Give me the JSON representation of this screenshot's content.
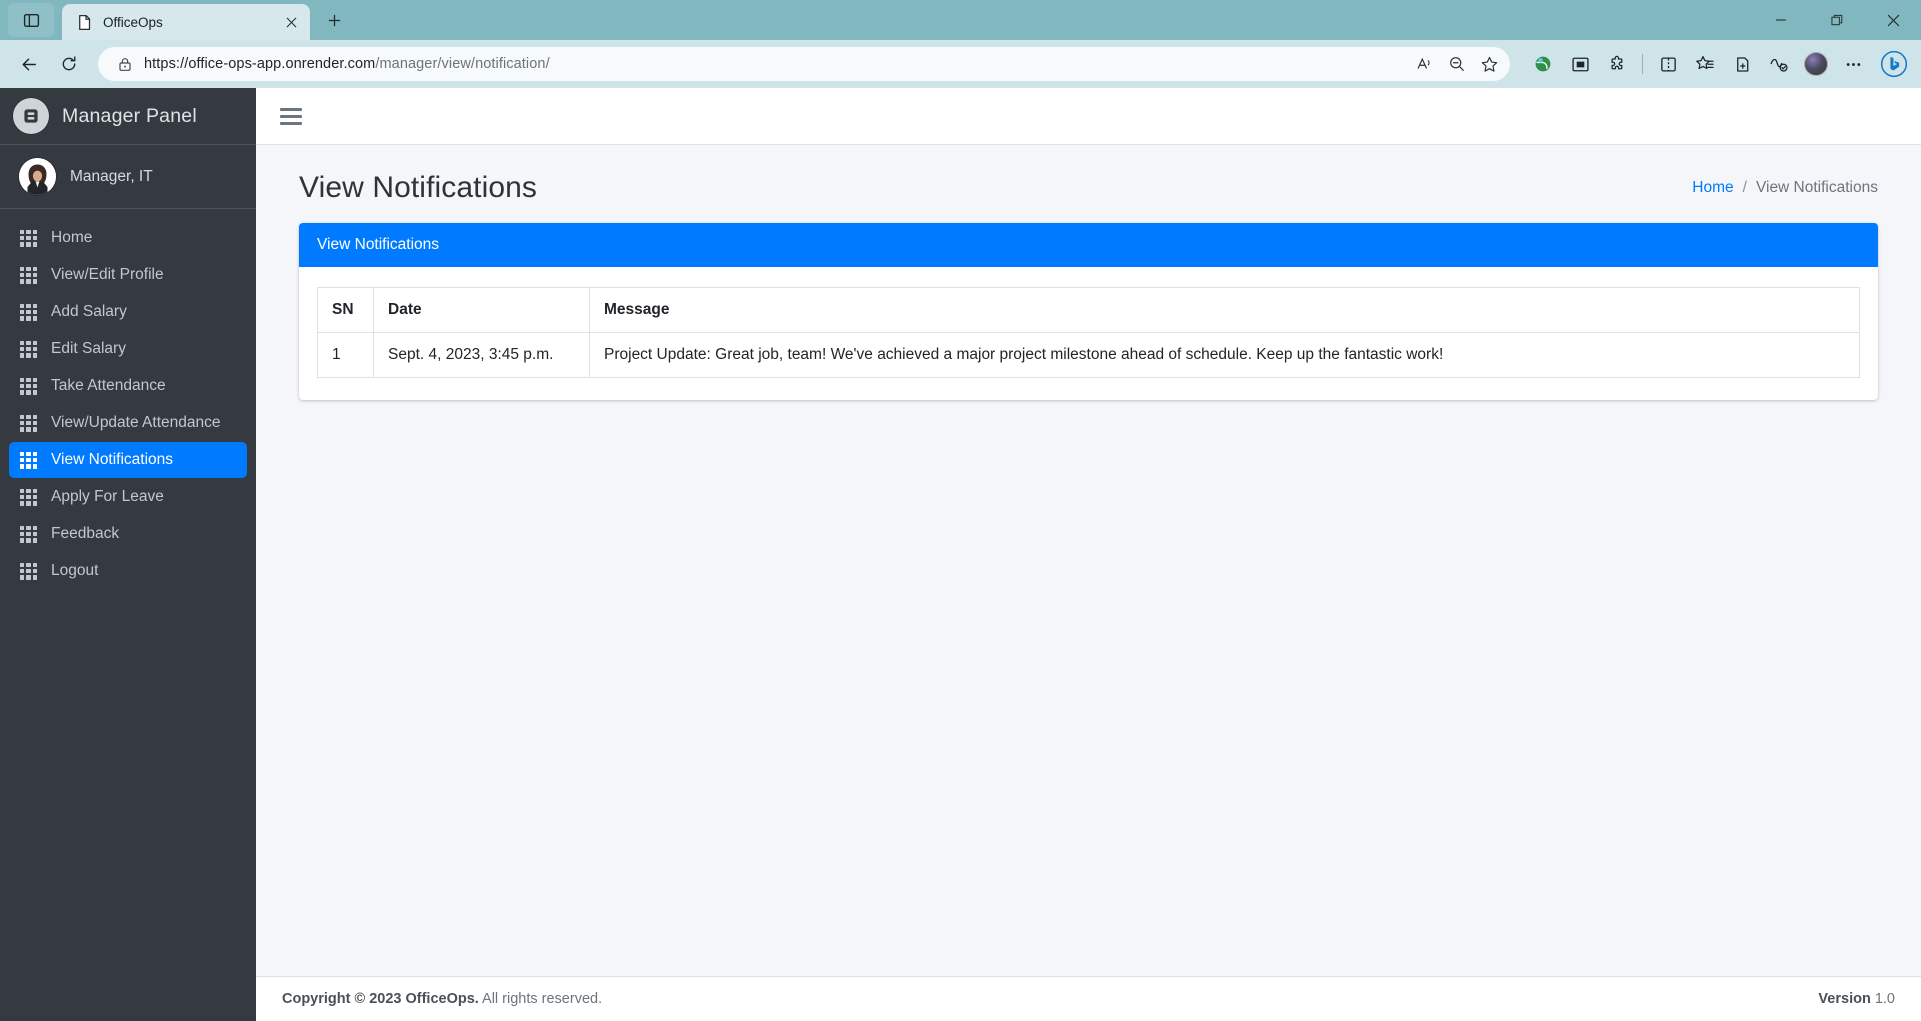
{
  "browser": {
    "tab": {
      "title": "OfficeOps",
      "favicon_icon": "page-icon",
      "close_icon": "close-icon"
    },
    "new_tab_label": "+",
    "tab_actions_icon": "tab-actions-icon",
    "window_controls": {
      "minimize": "minimize-icon",
      "maximize": "restore-icon",
      "close": "close-icon"
    },
    "nav": {
      "back_icon": "back-arrow-icon",
      "reload_icon": "reload-icon",
      "lock_icon": "lock-icon",
      "url_secure_prefix": "https://office-ops-app.onrender.com",
      "url_path": "/manager/view/notification/",
      "read_aloud_icon": "read-aloud-icon",
      "zoom_icon": "zoom-out-icon",
      "favorite_icon": "star-icon"
    },
    "extensions": [
      {
        "name": "globe-extension-icon"
      },
      {
        "name": "screenshot-extension-icon"
      },
      {
        "name": "puzzle-extensions-icon"
      },
      {
        "name": "split-screen-icon"
      },
      {
        "name": "collections-favorites-icon"
      },
      {
        "name": "collections-icon"
      },
      {
        "name": "browser-essentials-icon"
      },
      {
        "name": "profile-avatar"
      },
      {
        "name": "settings-more-icon"
      },
      {
        "name": "copilot-bing-icon"
      }
    ]
  },
  "sidebar": {
    "brand": {
      "label": "Manager Panel",
      "logo_icon": "officeops-logo-icon"
    },
    "user": {
      "name": "Manager, IT",
      "avatar_icon": "user-avatar"
    },
    "items": [
      {
        "label": "Home",
        "icon": "grid-icon",
        "active": false
      },
      {
        "label": "View/Edit Profile",
        "icon": "grid-icon",
        "active": false
      },
      {
        "label": "Add Salary",
        "icon": "grid-icon",
        "active": false
      },
      {
        "label": "Edit Salary",
        "icon": "grid-icon",
        "active": false
      },
      {
        "label": "Take Attendance",
        "icon": "grid-icon",
        "active": false
      },
      {
        "label": "View/Update Attendance",
        "icon": "grid-icon",
        "active": false
      },
      {
        "label": "View Notifications",
        "icon": "grid-icon",
        "active": true
      },
      {
        "label": "Apply For Leave",
        "icon": "grid-icon",
        "active": false
      },
      {
        "label": "Feedback",
        "icon": "grid-icon",
        "active": false
      },
      {
        "label": "Logout",
        "icon": "grid-icon",
        "active": false
      }
    ]
  },
  "topbar": {
    "menu_toggle_icon": "hamburger-menu-icon"
  },
  "page": {
    "title": "View Notifications",
    "breadcrumb": {
      "home": "Home",
      "separator": "/",
      "current": "View Notifications"
    }
  },
  "card": {
    "header": "View Notifications",
    "table": {
      "columns": [
        "SN",
        "Date",
        "Message"
      ],
      "rows": [
        {
          "sn": "1",
          "date": "Sept. 4, 2023, 3:45 p.m.",
          "message": "Project Update: Great job, team! We've achieved a major project milestone ahead of schedule. Keep up the fantastic work!"
        }
      ]
    }
  },
  "footer": {
    "copyright_bold": "Copyright © 2023 OfficeOps.",
    "copyright_rest": " All rights reserved.",
    "version_label": "Version",
    "version_value": " 1.0"
  },
  "colors": {
    "accent": "#007bff",
    "sidebar_bg": "#343a40",
    "chrome_bg": "#81b7bf",
    "page_bg": "#f4f6f9"
  }
}
